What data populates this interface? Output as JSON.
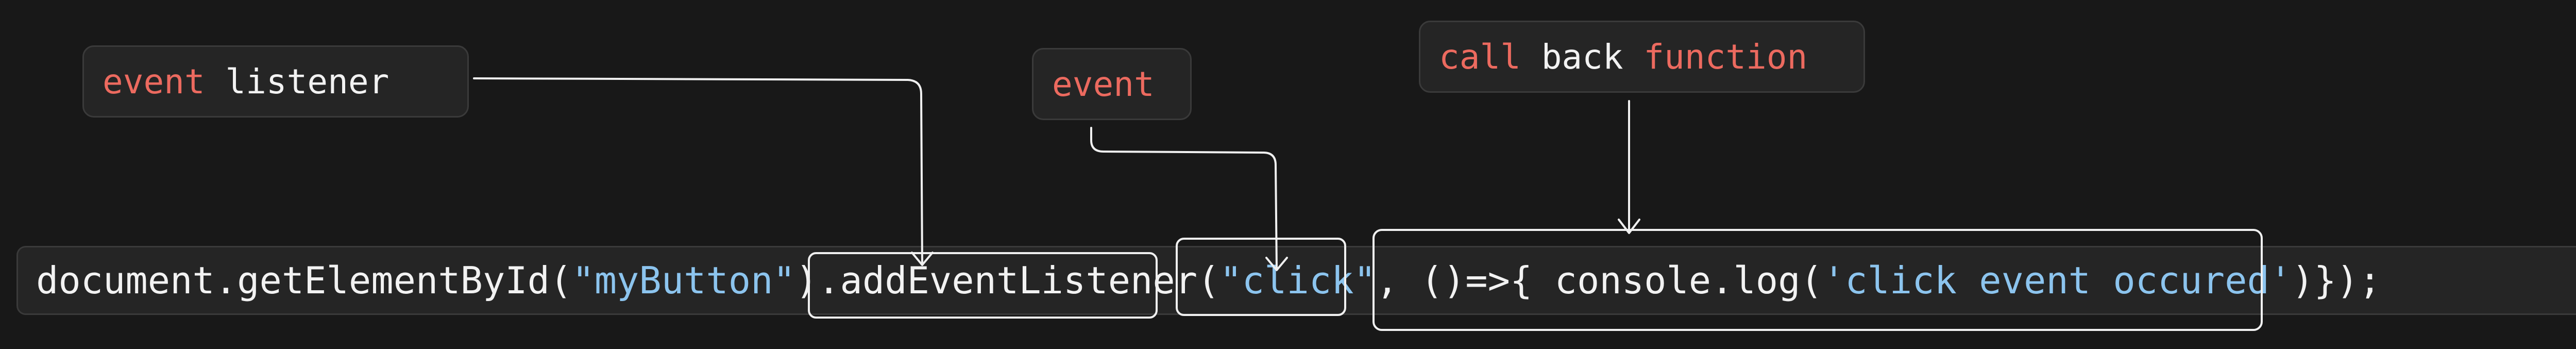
{
  "labels": {
    "listener": {
      "keyword": "event",
      "rest": " listener"
    },
    "event": {
      "keyword": "event"
    },
    "callback": {
      "keyword1": "call",
      "middle": " back ",
      "keyword2": "function"
    }
  },
  "code": {
    "prefix": "document.getElementById(",
    "id_string": "\"myButton\"",
    "after_id": ").",
    "method": "addEventListener",
    "open_paren": "(",
    "event_string": "\"click\"",
    "comma": ", ",
    "arrow_start": "()=>{ console.log(",
    "log_string": "'click event occured'",
    "arrow_end": ")}",
    "suffix": ");"
  },
  "colors": {
    "background": "#181818",
    "box": "#252525",
    "keyword": "#ec6a5f",
    "string": "#8cc4ee",
    "text": "#f2f2f2",
    "annotation": "#f0f0f0"
  }
}
